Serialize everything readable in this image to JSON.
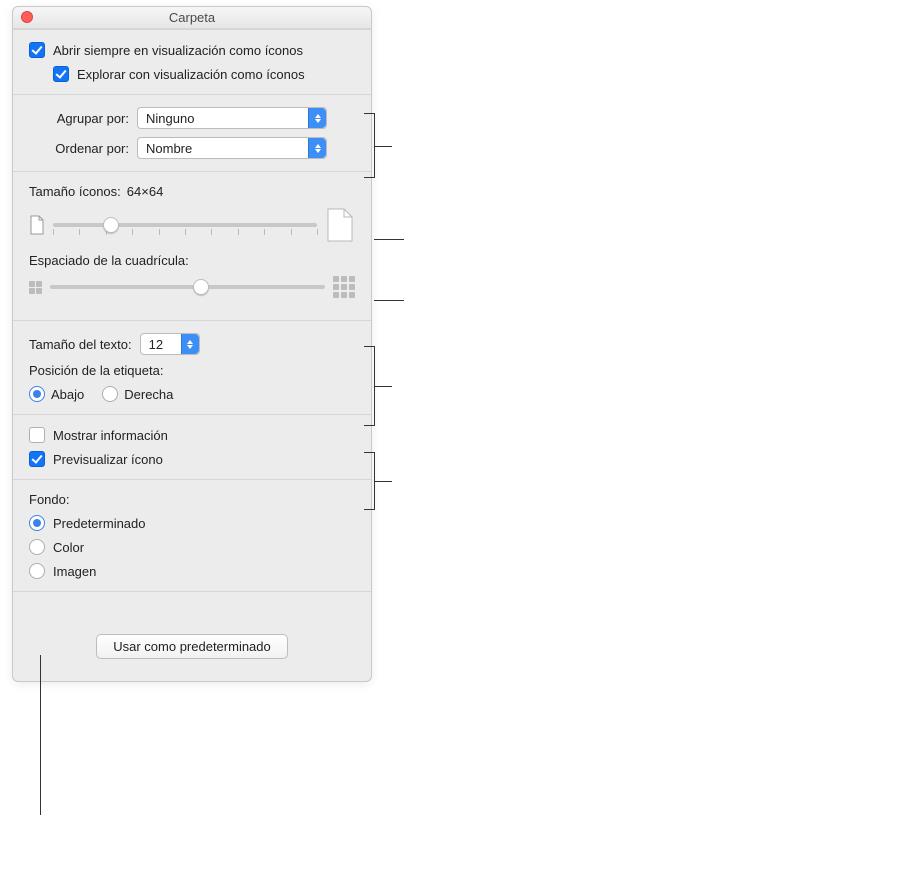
{
  "window": {
    "title": "Carpeta"
  },
  "top_checks": {
    "always_open": {
      "label": "Abrir siempre en visualización como íconos",
      "checked": true
    },
    "browse": {
      "label": "Explorar con visualización como íconos",
      "checked": true
    }
  },
  "sort": {
    "group_by_label": "Agrupar por:",
    "group_by_value": "Ninguno",
    "sort_by_label": "Ordenar por:",
    "sort_by_value": "Nombre"
  },
  "icon_size": {
    "label": "Tamaño íconos:",
    "value": "64×64",
    "slider_pct": 22
  },
  "grid_spacing": {
    "label": "Espaciado de la cuadrícula:",
    "slider_pct": 55
  },
  "text": {
    "size_label": "Tamaño del texto:",
    "size_value": "12",
    "pos_label": "Posición de la etiqueta:",
    "abajo": "Abajo",
    "derecha": "Derecha",
    "selected": "abajo"
  },
  "info": {
    "show_info": {
      "label": "Mostrar información",
      "checked": false
    },
    "preview_icon": {
      "label": "Previsualizar ícono",
      "checked": true
    }
  },
  "background": {
    "label": "Fondo:",
    "default": "Predeterminado",
    "color": "Color",
    "image": "Imagen",
    "selected": "default"
  },
  "footer": {
    "use_default": "Usar como predeterminado"
  }
}
